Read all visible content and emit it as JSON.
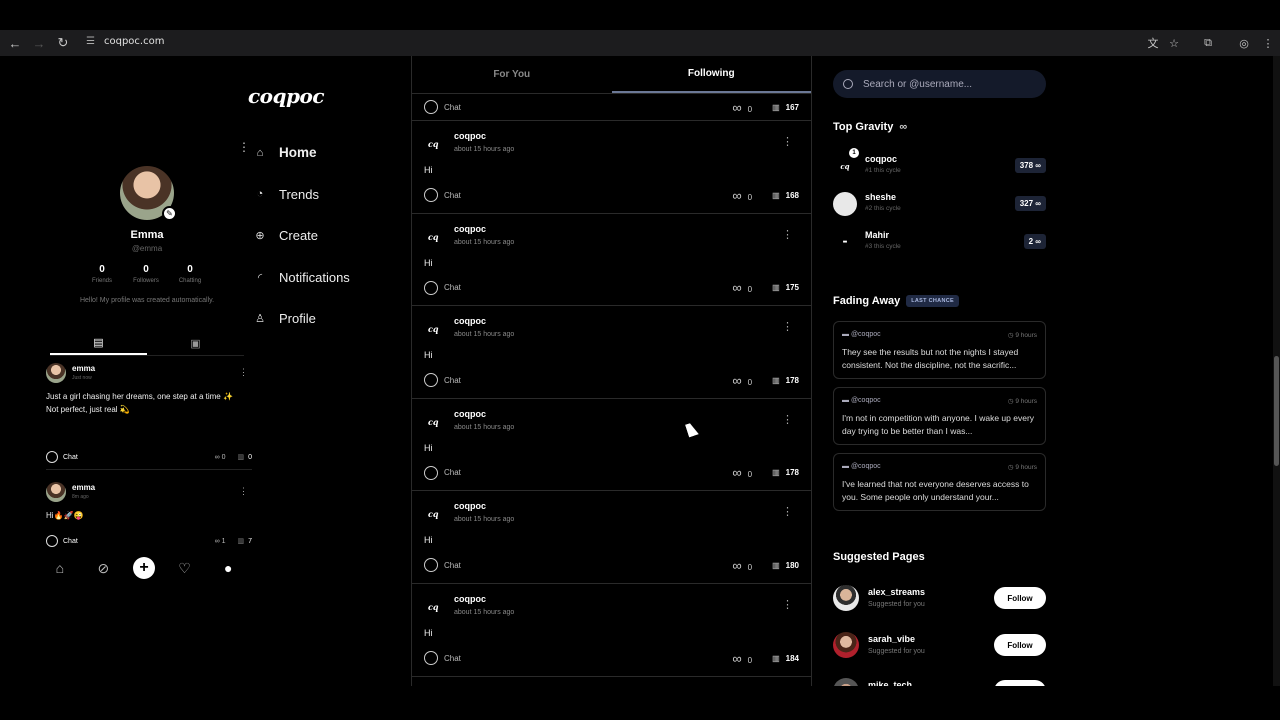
{
  "browser": {
    "url": "coqpoc.com"
  },
  "app": {
    "logo": "coqpoc"
  },
  "profile": {
    "name": "Emma",
    "handle": "@emma",
    "stats": [
      {
        "value": "0",
        "label": "Friends"
      },
      {
        "value": "0",
        "label": "Followers"
      },
      {
        "value": "0",
        "label": "Chatting"
      }
    ],
    "bio": "Hello! My profile was created automatically.",
    "posts": [
      {
        "author": "emma",
        "time": "Just now",
        "text": "Just a girl chasing her dreams, one step at a time ✨\nNot perfect, just real 💫",
        "chat": "Chat",
        "gravity": "0",
        "views": "0"
      },
      {
        "author": "emma",
        "time": "8m ago",
        "text": "Hi🔥🚀😜",
        "chat": "Chat",
        "gravity": "1",
        "views": "7"
      }
    ]
  },
  "nav": {
    "items": [
      {
        "label": "Home",
        "icon": "home-icon"
      },
      {
        "label": "Trends",
        "icon": "trends-icon"
      },
      {
        "label": "Create",
        "icon": "create-icon"
      },
      {
        "label": "Notifications",
        "icon": "notifications-icon"
      },
      {
        "label": "Profile",
        "icon": "profile-icon"
      }
    ]
  },
  "feed": {
    "tabs": [
      {
        "label": "For You",
        "active": false
      },
      {
        "label": "Following",
        "active": true
      }
    ],
    "top_partial": {
      "chat": "Chat",
      "gravity": "0",
      "views": "167"
    },
    "posts": [
      {
        "author": "coqpoc",
        "time": "about 15 hours ago",
        "text": "Hi",
        "chat": "Chat",
        "gravity": "0",
        "views": "168"
      },
      {
        "author": "coqpoc",
        "time": "about 15 hours ago",
        "text": "Hi",
        "chat": "Chat",
        "gravity": "0",
        "views": "175"
      },
      {
        "author": "coqpoc",
        "time": "about 15 hours ago",
        "text": "Hi",
        "chat": "Chat",
        "gravity": "0",
        "views": "178"
      },
      {
        "author": "coqpoc",
        "time": "about 15 hours ago",
        "text": "Hi",
        "chat": "Chat",
        "gravity": "0",
        "views": "178"
      },
      {
        "author": "coqpoc",
        "time": "about 15 hours ago",
        "text": "Hi",
        "chat": "Chat",
        "gravity": "0",
        "views": "180"
      },
      {
        "author": "coqpoc",
        "time": "about 15 hours ago",
        "text": "Hi",
        "chat": "Chat",
        "gravity": "0",
        "views": "184"
      }
    ]
  },
  "sidebar": {
    "search_placeholder": "Search or @username...",
    "top_gravity": {
      "title": "Top Gravity",
      "symbol": "∞",
      "users": [
        {
          "name": "coqpoc",
          "cycle": "#1 this cycle",
          "score": "378 ∞",
          "rank": "1"
        },
        {
          "name": "sheshe",
          "cycle": "#2 this cycle",
          "score": "327 ∞"
        },
        {
          "name": "Mahir",
          "cycle": "#3 this cycle",
          "score": "2 ∞"
        }
      ]
    },
    "fading_away": {
      "title": "Fading Away",
      "badge": "LAST CHANCE",
      "items": [
        {
          "handle": "@coqpoc",
          "time": "9 hours",
          "text": "They see the results but not the nights I stayed consistent. Not the discipline, not the sacrific..."
        },
        {
          "handle": "@coqpoc",
          "time": "9 hours",
          "text": "I'm not in competition with anyone. I wake up every day trying to be better than I was..."
        },
        {
          "handle": "@coqpoc",
          "time": "9 hours",
          "text": "I've learned that not everyone deserves access to you. Some people only understand your..."
        }
      ]
    },
    "suggested": {
      "title": "Suggested Pages",
      "pages": [
        {
          "name": "alex_streams",
          "sub": "Suggested for you",
          "button": "Follow"
        },
        {
          "name": "sarah_vibe",
          "sub": "Suggested for you",
          "button": "Follow"
        },
        {
          "name": "mike_tech",
          "sub": "",
          "button": ""
        }
      ]
    }
  },
  "colors": {
    "background": "#000000",
    "accent": "#6b7896",
    "score_badge": "#1d2436"
  }
}
